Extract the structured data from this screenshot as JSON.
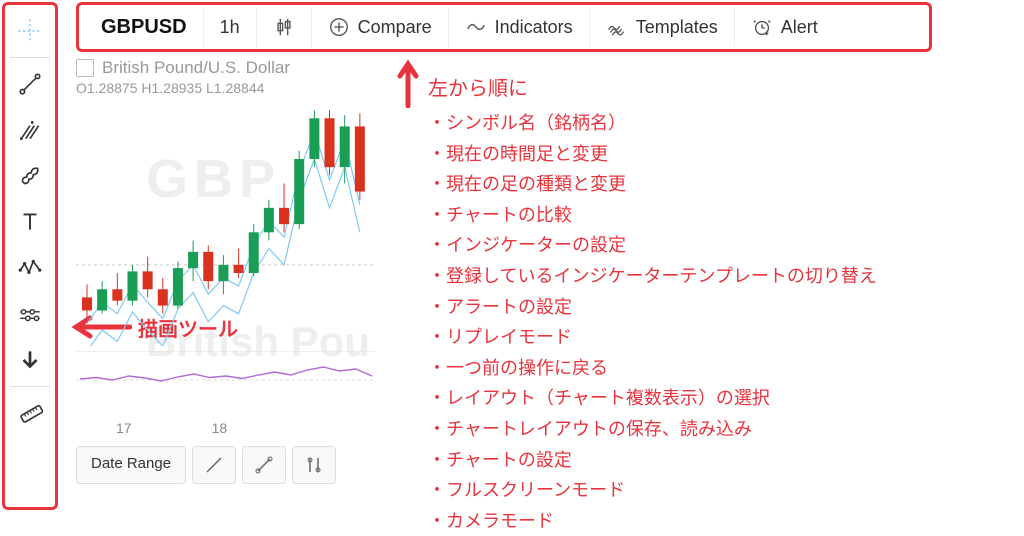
{
  "toolbar": {
    "symbol": "GBPUSD",
    "timeframe": "1h",
    "compare_label": "Compare",
    "indicators_label": "Indicators",
    "templates_label": "Templates",
    "alert_label": "Alert"
  },
  "chart": {
    "title": "British Pound/U.S. Dollar",
    "ohlc": "O1.28875  H1.28935  L1.28844",
    "watermark1": "GBP",
    "watermark2": "British Pou",
    "x_ticks": [
      "17",
      "18"
    ]
  },
  "bottom": {
    "date_range": "Date Range"
  },
  "annotations": {
    "draw_tools": "描画ツール",
    "heading": "左から順に",
    "items": [
      "シンボル名（銘柄名）",
      "現在の時間足と変更",
      "現在の足の種類と変更",
      "チャートの比較",
      "インジケーターの設定",
      "登録しているインジケーターテンプレートの切り替え",
      "アラートの設定",
      "リプレイモード",
      "一つ前の操作に戻る",
      "レイアウト（チャート複数表示）の選択",
      "チャートレイアウトの保存、読み込み",
      "チャートの設定",
      "フルスクリーンモード",
      "カメラモード"
    ]
  },
  "chart_data": {
    "type": "line",
    "title": "British Pound/U.S. Dollar",
    "xlabel": "",
    "ylabel": "",
    "x_ticks": [
      "17",
      "18"
    ],
    "ohlc": {
      "open": 1.28875,
      "high": 1.28935,
      "low": 1.28844
    },
    "candles": [
      {
        "x": 0,
        "open": 1.278,
        "high": 1.2788,
        "low": 1.2768,
        "close": 1.2772
      },
      {
        "x": 1,
        "open": 1.2772,
        "high": 1.279,
        "low": 1.277,
        "close": 1.2785
      },
      {
        "x": 2,
        "open": 1.2785,
        "high": 1.2795,
        "low": 1.2775,
        "close": 1.2778
      },
      {
        "x": 3,
        "open": 1.2778,
        "high": 1.28,
        "low": 1.2775,
        "close": 1.2796
      },
      {
        "x": 4,
        "open": 1.2796,
        "high": 1.2805,
        "low": 1.278,
        "close": 1.2785
      },
      {
        "x": 5,
        "open": 1.2785,
        "high": 1.2792,
        "low": 1.277,
        "close": 1.2775
      },
      {
        "x": 6,
        "open": 1.2775,
        "high": 1.2802,
        "low": 1.2773,
        "close": 1.2798
      },
      {
        "x": 7,
        "open": 1.2798,
        "high": 1.2815,
        "low": 1.279,
        "close": 1.2808
      },
      {
        "x": 8,
        "open": 1.2808,
        "high": 1.2812,
        "low": 1.2785,
        "close": 1.279
      },
      {
        "x": 9,
        "open": 1.279,
        "high": 1.2806,
        "low": 1.2782,
        "close": 1.28
      },
      {
        "x": 10,
        "open": 1.28,
        "high": 1.281,
        "low": 1.2792,
        "close": 1.2795
      },
      {
        "x": 11,
        "open": 1.2795,
        "high": 1.2825,
        "low": 1.2793,
        "close": 1.282
      },
      {
        "x": 12,
        "open": 1.282,
        "high": 1.284,
        "low": 1.2815,
        "close": 1.2835
      },
      {
        "x": 13,
        "open": 1.2835,
        "high": 1.285,
        "low": 1.282,
        "close": 1.2825
      },
      {
        "x": 14,
        "open": 1.2825,
        "high": 1.287,
        "low": 1.2822,
        "close": 1.2865
      },
      {
        "x": 15,
        "open": 1.2865,
        "high": 1.2895,
        "low": 1.286,
        "close": 1.289
      },
      {
        "x": 16,
        "open": 1.289,
        "high": 1.2895,
        "low": 1.2855,
        "close": 1.286
      },
      {
        "x": 17,
        "open": 1.286,
        "high": 1.2892,
        "low": 1.285,
        "close": 1.2885
      },
      {
        "x": 18,
        "open": 1.2885,
        "high": 1.2893,
        "low": 1.284,
        "close": 1.2845
      }
    ],
    "ylim": [
      1.276,
      1.29
    ],
    "oscillator": {
      "type": "line",
      "values": [
        52,
        55,
        50,
        58,
        54,
        48,
        56,
        62,
        55,
        58,
        53,
        60,
        66,
        60,
        70,
        76,
        68,
        72,
        58
      ],
      "ylim": [
        0,
        100
      ]
    }
  }
}
